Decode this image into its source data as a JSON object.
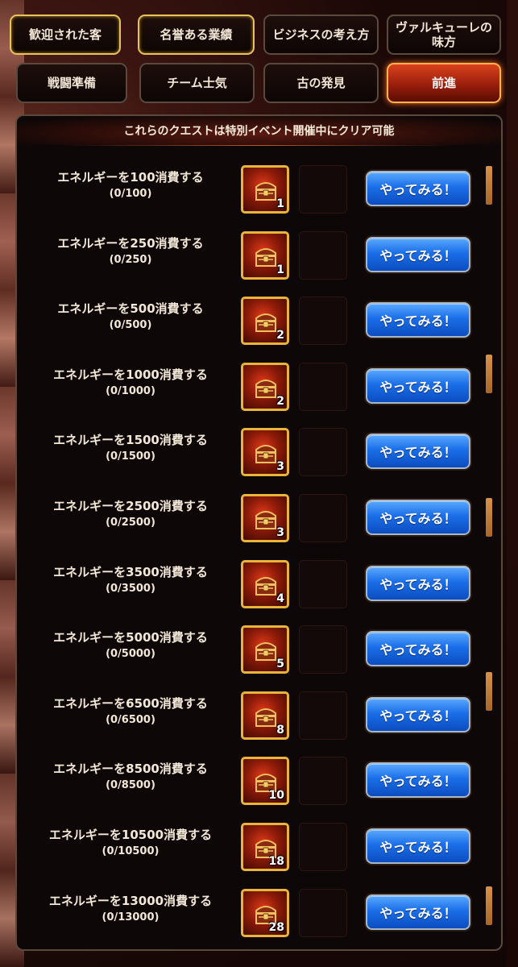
{
  "tabs": [
    {
      "label": "歓迎された客",
      "state": "gold"
    },
    {
      "label": "名誉ある業績",
      "state": "gold"
    },
    {
      "label": "ビジネスの考え方",
      "state": "normal"
    },
    {
      "label": "ヴァルキューレの味方",
      "state": "normal"
    },
    {
      "label": "戦闘準備",
      "state": "normal"
    },
    {
      "label": "チーム士気",
      "state": "normal"
    },
    {
      "label": "古の発見",
      "state": "normal"
    },
    {
      "label": "前進",
      "state": "active"
    }
  ],
  "panel": {
    "header": "これらのクエストは特別イベント開催中にクリア可能"
  },
  "quests": [
    {
      "title": "エネルギーを100消費する",
      "progress": "(0/100)",
      "reward_count": "1",
      "button": "やってみる！"
    },
    {
      "title": "エネルギーを250消費する",
      "progress": "(0/250)",
      "reward_count": "1",
      "button": "やってみる！"
    },
    {
      "title": "エネルギーを500消費する",
      "progress": "(0/500)",
      "reward_count": "2",
      "button": "やってみる！"
    },
    {
      "title": "エネルギーを1000消費する",
      "progress": "(0/1000)",
      "reward_count": "2",
      "button": "やってみる！"
    },
    {
      "title": "エネルギーを1500消費する",
      "progress": "(0/1500)",
      "reward_count": "3",
      "button": "やってみる！"
    },
    {
      "title": "エネルギーを2500消費する",
      "progress": "(0/2500)",
      "reward_count": "3",
      "button": "やってみる！"
    },
    {
      "title": "エネルギーを3500消費する",
      "progress": "(0/3500)",
      "reward_count": "4",
      "button": "やってみる！"
    },
    {
      "title": "エネルギーを5000消費する",
      "progress": "(0/5000)",
      "reward_count": "5",
      "button": "やってみる！"
    },
    {
      "title": "エネルギーを6500消費する",
      "progress": "(0/6500)",
      "reward_count": "8",
      "button": "やってみる！"
    },
    {
      "title": "エネルギーを8500消費する",
      "progress": "(0/8500)",
      "reward_count": "10",
      "button": "やってみる！"
    },
    {
      "title": "エネルギーを10500消費する",
      "progress": "(0/10500)",
      "reward_count": "18",
      "button": "やってみる！"
    },
    {
      "title": "エネルギーを13000消費する",
      "progress": "(0/13000)",
      "reward_count": "28",
      "button": "やってみる！"
    }
  ],
  "icons": {
    "reward": "treasure-chest-icon"
  }
}
